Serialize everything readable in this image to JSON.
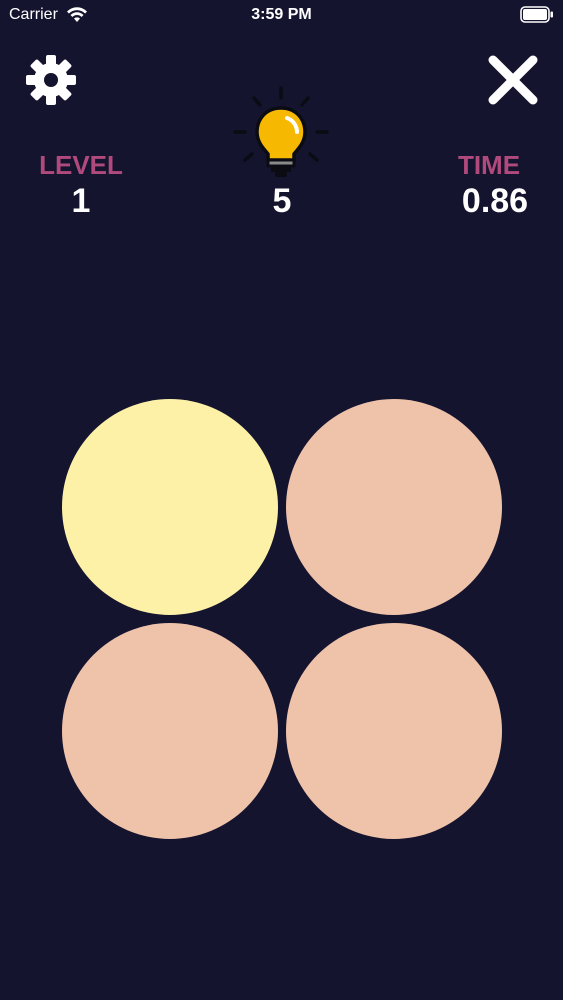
{
  "status_bar": {
    "carrier": "Carrier",
    "time": "3:59 PM",
    "wifi_icon": "wifi-icon",
    "battery_icon": "battery-icon"
  },
  "toolbar": {
    "settings_icon": "gear-icon",
    "close_icon": "close-icon"
  },
  "stats": {
    "level_label": "LEVEL",
    "level_value": "1",
    "hints_icon": "lightbulb-icon",
    "hints_value": "5",
    "time_label": "TIME",
    "time_value": "0.86"
  },
  "colors": {
    "background": "#15142f",
    "label": "#b04a7c",
    "value": "#ffffff",
    "tile_default": "#efc2aa",
    "tile_odd": "#fdf1a8",
    "bulb": "#f7b801"
  },
  "board": {
    "tiles": [
      {
        "color": "#fdf1a8",
        "odd": true
      },
      {
        "color": "#efc2aa",
        "odd": false
      },
      {
        "color": "#efc2aa",
        "odd": false
      },
      {
        "color": "#efc2aa",
        "odd": false
      }
    ]
  }
}
